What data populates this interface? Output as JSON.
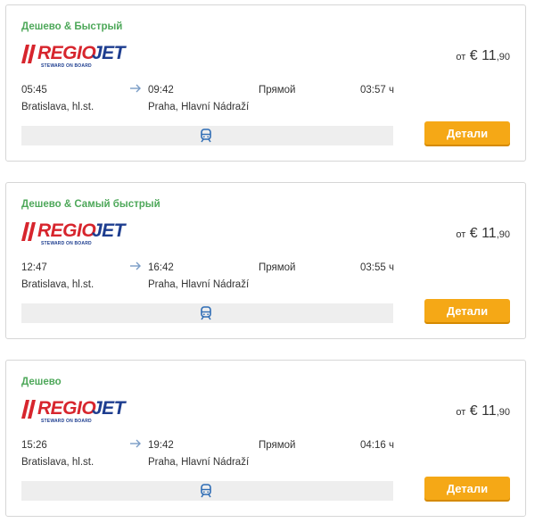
{
  "brand_colors": {
    "tag_green": "#4ea85a",
    "button_orange": "#f5a816",
    "logo_red": "#d7252d",
    "logo_blue": "#1d3d8f"
  },
  "results": [
    {
      "tag": "Дешево & Быстрый",
      "carrier": {
        "name_part1": "REGIO",
        "name_part2": "JET",
        "slogan": "STEWARD ON BOARD"
      },
      "price": {
        "prefix": "от",
        "currency": "€",
        "whole": "11",
        "decimal": ",90"
      },
      "departure": {
        "time": "05:45",
        "station": "Bratislava, hl.st."
      },
      "arrival": {
        "time": "09:42",
        "station": "Praha, Hlavní Nádraží"
      },
      "connection": "Прямой",
      "duration": "03:57 ч",
      "transport_icon": "train-icon",
      "button": "Детали"
    },
    {
      "tag": "Дешево & Самый быстрый",
      "carrier": {
        "name_part1": "REGIO",
        "name_part2": "JET",
        "slogan": "STEWARD ON BOARD"
      },
      "price": {
        "prefix": "от",
        "currency": "€",
        "whole": "11",
        "decimal": ",90"
      },
      "departure": {
        "time": "12:47",
        "station": "Bratislava, hl.st."
      },
      "arrival": {
        "time": "16:42",
        "station": "Praha, Hlavní Nádraží"
      },
      "connection": "Прямой",
      "duration": "03:55 ч",
      "transport_icon": "train-icon",
      "button": "Детали"
    },
    {
      "tag": "Дешево",
      "carrier": {
        "name_part1": "REGIO",
        "name_part2": "JET",
        "slogan": "STEWARD ON BOARD"
      },
      "price": {
        "prefix": "от",
        "currency": "€",
        "whole": "11",
        "decimal": ",90"
      },
      "departure": {
        "time": "15:26",
        "station": "Bratislava, hl.st."
      },
      "arrival": {
        "time": "19:42",
        "station": "Praha, Hlavní Nádraží"
      },
      "connection": "Прямой",
      "duration": "04:16 ч",
      "transport_icon": "train-icon",
      "button": "Детали"
    }
  ]
}
